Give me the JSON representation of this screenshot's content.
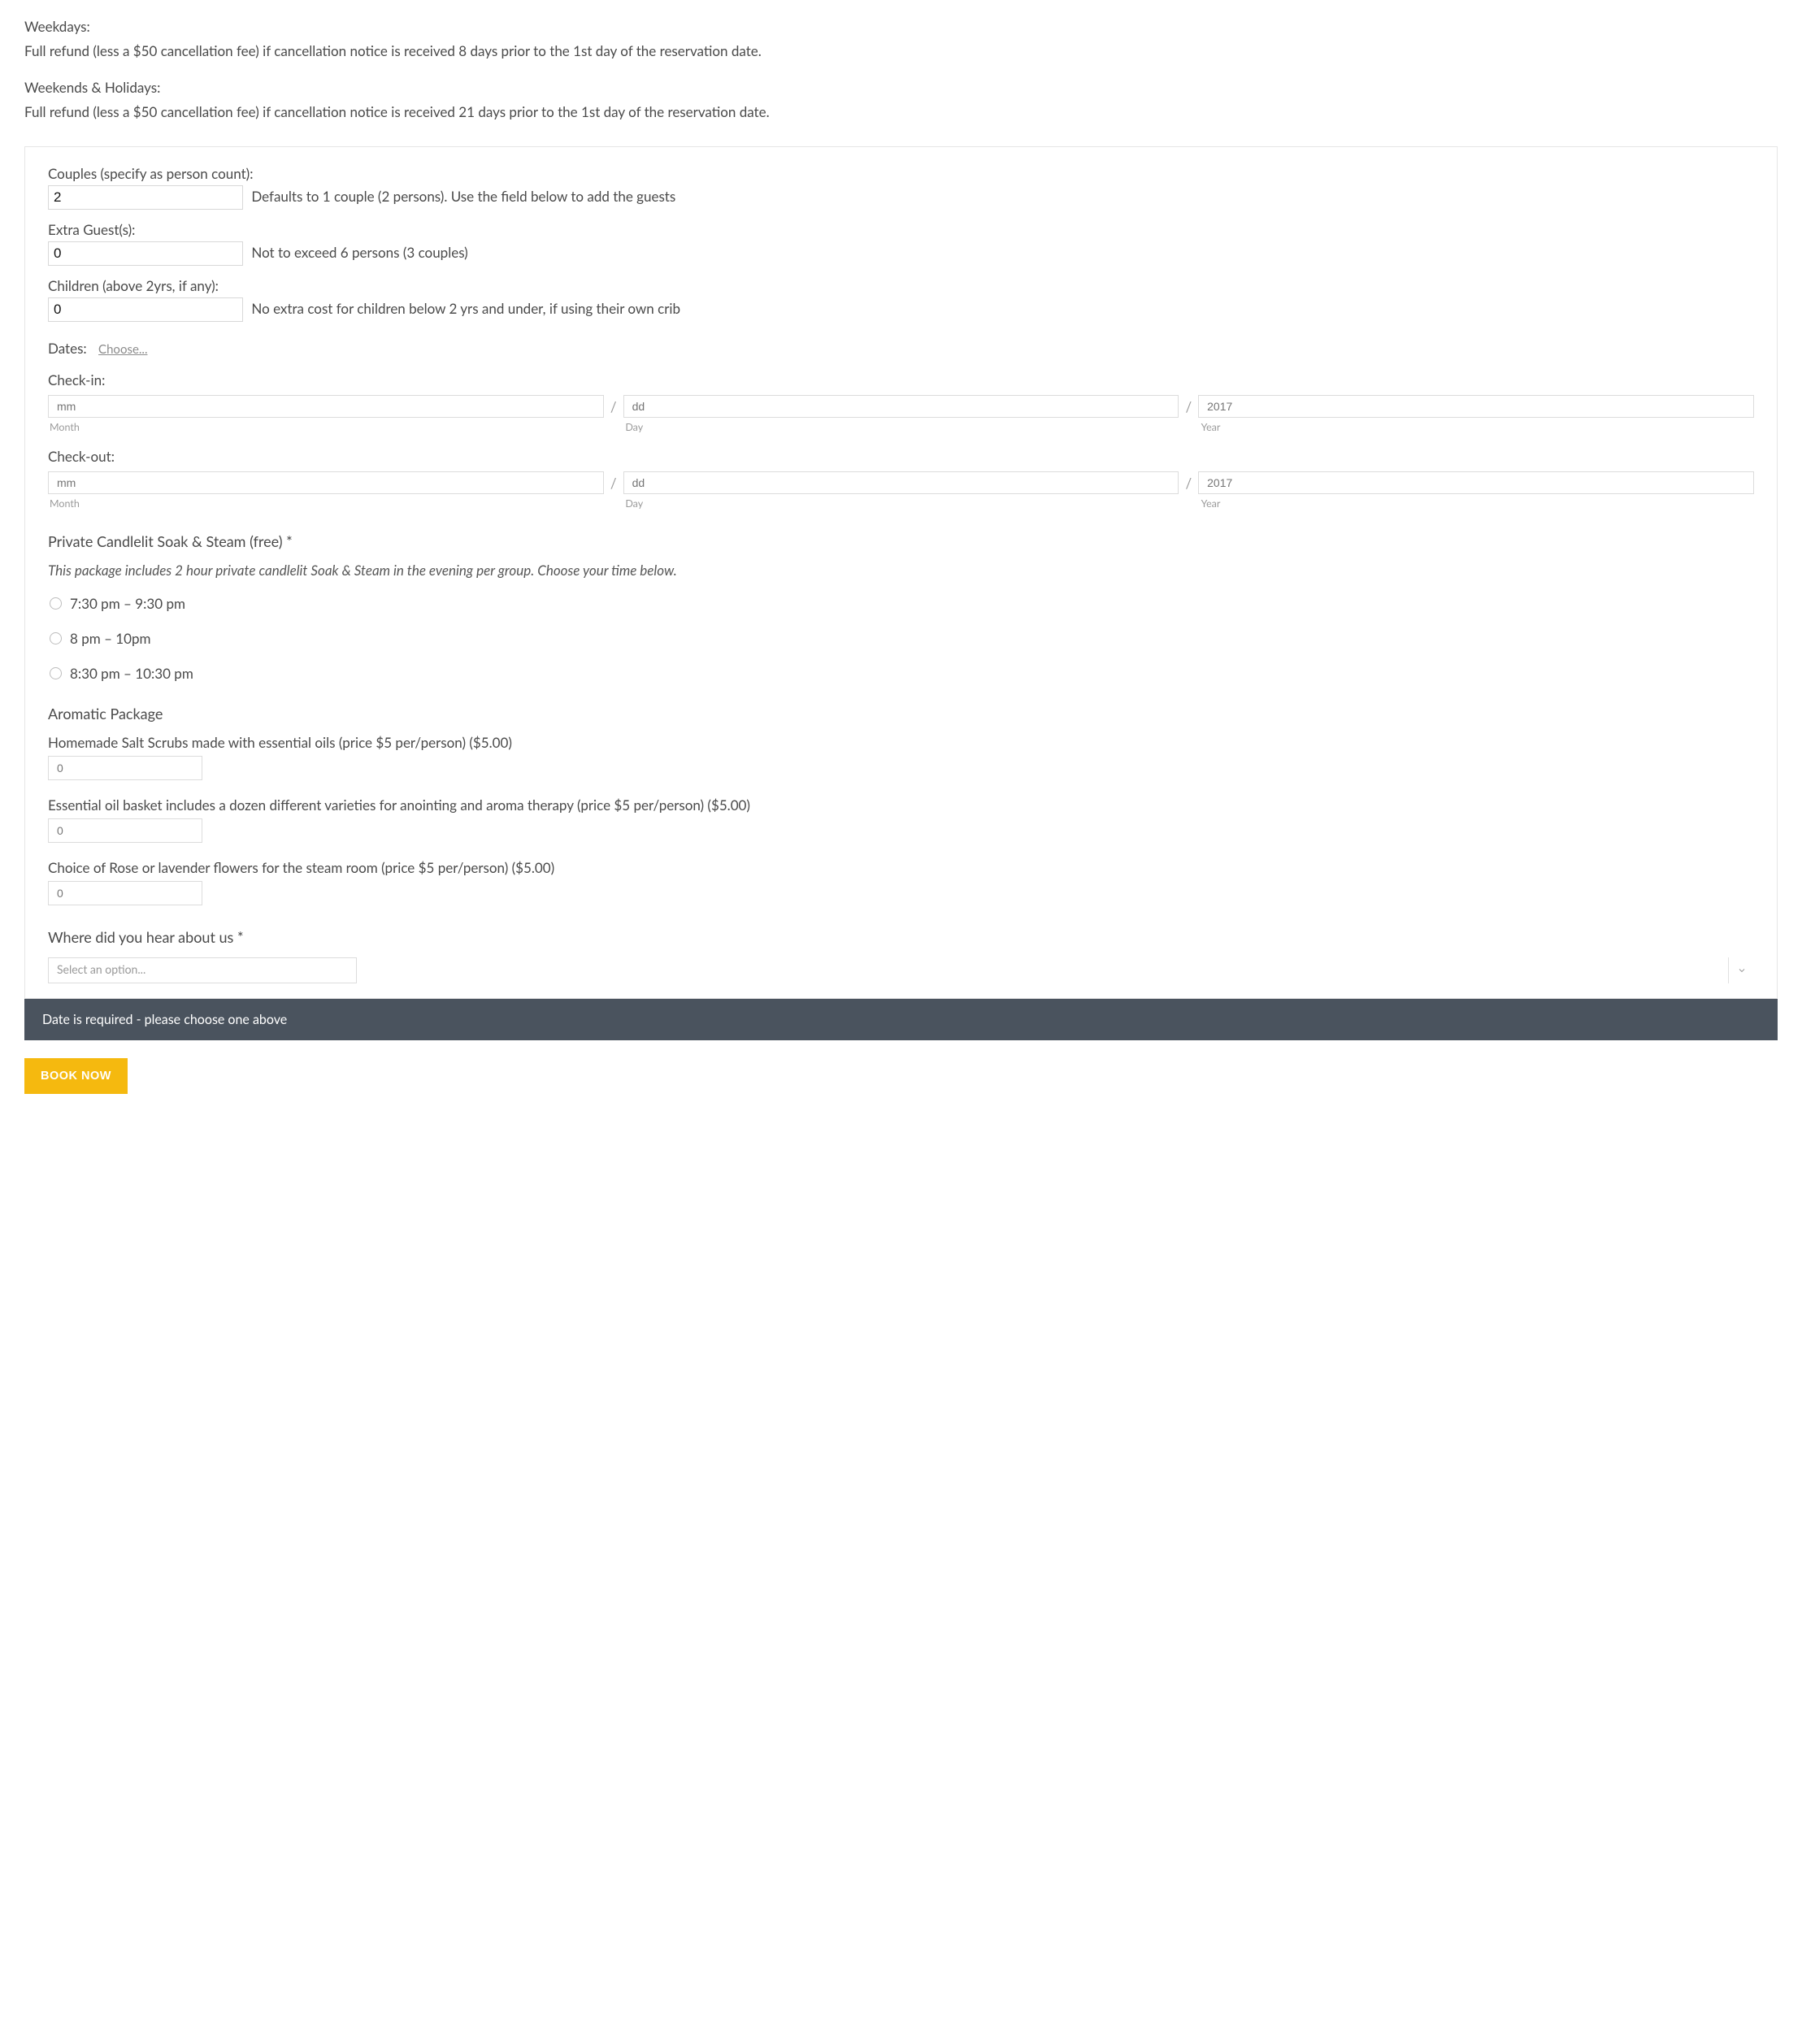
{
  "intro": {
    "weekdays_title": "Weekdays:",
    "weekdays_text": "Full refund (less a $50 cancellation fee) if cancellation notice is received 8 days prior to the 1st day of the reservation date.",
    "weekends_title": "Weekends & Holidays:",
    "weekends_text": "Full refund (less a $50 cancellation fee) if cancellation notice is received 21 days prior to the 1st day of the reservation date."
  },
  "couples": {
    "label": "Couples (specify as person count):",
    "value": "2",
    "note": "Defaults to 1 couple (2 persons). Use the field below to add the guests"
  },
  "extra": {
    "label": "Extra Guest(s):",
    "value": "0",
    "note": "Not to exceed 6 persons (3 couples)"
  },
  "children": {
    "label": "Children (above 2yrs, if any):",
    "value": "0",
    "note": "No extra cost for children below 2 yrs and under, if using their own crib"
  },
  "dates": {
    "label": "Dates:",
    "choose": "Choose...",
    "checkin_label": "Check-in:",
    "checkout_label": "Check-out:",
    "mm": "mm",
    "dd": "dd",
    "yyyy": "2017",
    "month_sub": "Month",
    "day_sub": "Day",
    "year_sub": "Year"
  },
  "soak": {
    "heading": "Private Candlelit Soak & Steam (free) *",
    "desc": "This package includes 2 hour private candlelit Soak & Steam in the evening per group. Choose your time below.",
    "options": [
      "7:30 pm – 9:30 pm",
      "8 pm – 10pm",
      "8:30 pm – 10:30 pm"
    ]
  },
  "aromatic": {
    "heading": "Aromatic Package",
    "items": [
      {
        "label": "Homemade Salt Scrubs made with essential oils (price $5 per/person) ($5.00)",
        "placeholder": "0"
      },
      {
        "label": "Essential oil basket includes a dozen different varieties for anointing and aroma therapy (price $5 per/person) ($5.00)",
        "placeholder": "0"
      },
      {
        "label": "Choice of Rose or lavender flowers for the steam room (price $5 per/person) ($5.00)",
        "placeholder": "0"
      }
    ]
  },
  "hear": {
    "heading": "Where did you hear about us *",
    "placeholder": "Select an option..."
  },
  "error": "Date is required - please choose one above",
  "book_btn": "BOOK NOW"
}
